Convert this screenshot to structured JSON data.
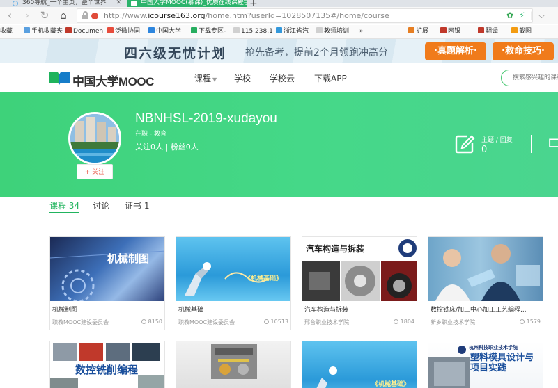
{
  "browser": {
    "tabs": [
      {
        "label": "360导航_一个主页，整个世界"
      },
      {
        "label": "中国大学MOOC(慕课)_优质在线课程学习平台"
      }
    ],
    "new_tab": "+",
    "url_prefix": "http://www.",
    "url_domain": "icourse163.org",
    "url_rest": "/home.htm?userId=1028507135#/home/course",
    "bookmarks": [
      {
        "label": "收藏",
        "color": "#f0a030"
      },
      {
        "label": "手机收藏夹",
        "color": "#5aa0e0"
      },
      {
        "label": "Documen",
        "color": "#c0392b"
      },
      {
        "label": "泛微协同",
        "color": "#e74c3c"
      },
      {
        "label": "中国大学",
        "color": "#2e86de"
      },
      {
        "label": "下载专区-",
        "color": "#27ae60"
      },
      {
        "label": "115.238.1",
        "color": "#888888"
      },
      {
        "label": "浙江省汽",
        "color": "#3498db"
      },
      {
        "label": "教师培训",
        "color": "#888888"
      },
      {
        "label": "»",
        "color": ""
      },
      {
        "label": "扩展",
        "color": "#e67e22"
      },
      {
        "label": "网银",
        "color": "#c0392b"
      },
      {
        "label": "翻译",
        "color": "#c0392b"
      },
      {
        "label": "截图",
        "color": "#f39c12"
      }
    ]
  },
  "banner": {
    "headline": "四六级无忧计划",
    "subline": "抢先备考，提前2个月领跑冲高分",
    "button1": "·真题解析·",
    "button2": "·救命技巧·"
  },
  "header": {
    "logo": "中国大学",
    "logo_en": "MOOC",
    "nav": [
      "课程",
      "学校",
      "学校云",
      "下载APP"
    ],
    "search_placeholder": "搜索感兴趣的课程"
  },
  "profile": {
    "username": "NBNHSL-2019-xudayou",
    "role": "在职 - 教育",
    "follows": "关注0人 | 粉丝0人",
    "follow_button": "+ 关注",
    "stat_label": "主题 / 回复",
    "stat_value": "0"
  },
  "tabs": [
    {
      "label": "课程",
      "count": "34"
    },
    {
      "label": "讨论",
      "count": ""
    },
    {
      "label": "证书",
      "count": "1"
    }
  ],
  "courses": [
    {
      "title": "机械制图",
      "org": "职教MOOC建设委员会",
      "count": "8150",
      "thumb_text": "机械制图"
    },
    {
      "title": "机械基础",
      "org": "职教MOOC建设委员会",
      "count": "10513",
      "thumb_text": "《机械基础》"
    },
    {
      "title": "汽车构造与拆装",
      "org": "邢台职业技术学院",
      "count": "1804",
      "thumb_text": "汽车构造与拆装"
    },
    {
      "title": "数控铣床/加工中心加工工艺编程...",
      "org": "新乡职业技术学院",
      "count": "1579",
      "thumb_text": ""
    },
    {
      "title": "",
      "org": "",
      "count": "",
      "thumb_text": "数控铣削编程"
    },
    {
      "title": "",
      "org": "",
      "count": "",
      "thumb_text": ""
    },
    {
      "title": "",
      "org": "",
      "count": "",
      "thumb_text": "《机械基础》"
    },
    {
      "title": "",
      "org": "",
      "count": "",
      "thumb_text": "塑料模具设计与项目实践"
    }
  ],
  "colors": {
    "brand_green": "#21b45e",
    "hero_green": "#45d888",
    "banner_orange": "#f07b1b"
  }
}
